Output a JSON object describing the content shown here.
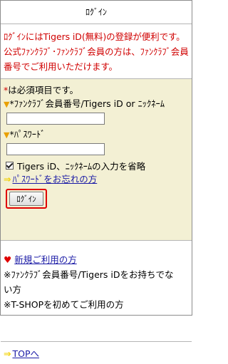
{
  "header": {
    "title": "ﾛｸﾞｲﾝ"
  },
  "notice": {
    "line1": "ﾛｸﾞｲﾝにはTigers iD(無料)の登録が便利です。",
    "line2": "公式ﾌｧﾝｸﾗﾌﾞ･ﾌｧﾝｸﾗﾌﾞ会員の方は、ﾌｧﾝｸﾗﾌﾞ会員",
    "line3": "番号でご利用いただけます。"
  },
  "form": {
    "required_mark": "*",
    "required_note": "は必須項目です。",
    "id_arrow": "▼",
    "id_label": "*ﾌｧﾝｸﾗﾌﾞ会員番号/Tigers iD or ﾆｯｸﾈｰﾑ",
    "id_value": "",
    "pw_arrow": "▼",
    "pw_label": "*ﾊﾟｽﾜｰﾄﾞ",
    "pw_value": "",
    "remember_label": "Tigers iD、ﾆｯｸﾈｰﾑの入力を省略",
    "remember_checked": true,
    "forgot_arrow": "⇒",
    "forgot_link": "ﾊﾟｽﾜｰﾄﾞをお忘れの方",
    "login_button": "ﾛｸﾞｲﾝ"
  },
  "register": {
    "heart": "♥",
    "new_link": "新規ご利用の方",
    "note1": "※ﾌｧﾝｸﾗﾌﾞ会員番号/Tigers iDをお持ちでな",
    "note2": "い方",
    "note3": "※T-SHOPを初めてご利用の方"
  },
  "footer": {
    "arrow": "⇒",
    "top_link": "TOPへ"
  },
  "colors": {
    "accent_red": "#d00000",
    "form_bg": "#f3f0d4",
    "link": "#1a1aa6"
  }
}
